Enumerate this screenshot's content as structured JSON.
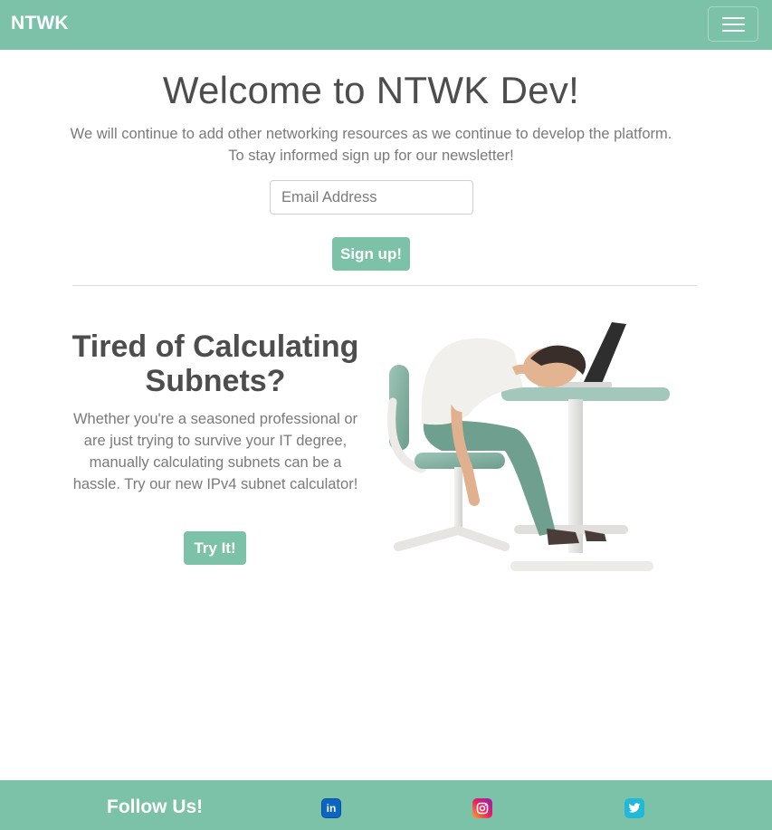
{
  "nav": {
    "brand": "NTWK"
  },
  "hero": {
    "title": "Welcome to NTWK Dev!",
    "line1": "We will continue to add other networking resources as we continue to develop the platform.",
    "line2": "To stay informed sign up for our newsletter!",
    "email_placeholder": "Email Address",
    "signup_label": "Sign up!"
  },
  "promo": {
    "title_line1": "Tired of Calculating",
    "title_line2": "Subnets?",
    "text": "Whether you're a seasoned professional or are just trying to survive your IT degree, manually calculating subnets can be a hassle. Try our new IPv4 subnet calculator!",
    "button_label": "Try It!"
  },
  "footer": {
    "follow_label": "Follow Us!",
    "socials": [
      {
        "icon": "linkedin-icon",
        "glyph": "in"
      },
      {
        "icon": "instagram-icon"
      },
      {
        "icon": "twitter-icon"
      }
    ]
  },
  "colors": {
    "accent": "#7cc2a9",
    "heading": "#4d4d4d",
    "body_text": "#7a7a7a"
  }
}
